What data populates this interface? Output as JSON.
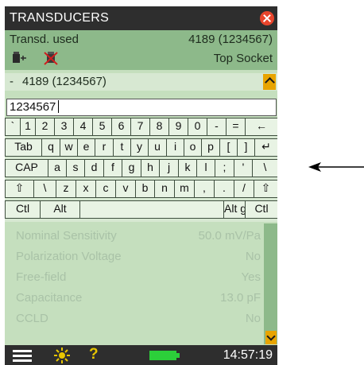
{
  "title": "TRANSDUCERS",
  "header": {
    "label": "Transd. used",
    "transducer": "4189 (1234567)",
    "socket": "Top Socket"
  },
  "dropdown": {
    "prefix": "-",
    "value": "4189 (1234567)"
  },
  "input": {
    "value": "1234567"
  },
  "keyboard": {
    "rows": [
      [
        "`",
        "1",
        "2",
        "3",
        "4",
        "5",
        "6",
        "7",
        "8",
        "9",
        "0",
        "-",
        "=",
        "←"
      ],
      [
        "Tab",
        "q",
        "w",
        "e",
        "r",
        "t",
        "y",
        "u",
        "i",
        "o",
        "p",
        "[",
        "]",
        "↵"
      ],
      [
        "CAP",
        "a",
        "s",
        "d",
        "f",
        "g",
        "h",
        "j",
        "k",
        "l",
        ";",
        "'",
        "\\"
      ],
      [
        "⇧",
        "\\",
        "z",
        "x",
        "c",
        "v",
        "b",
        "n",
        "m",
        ",",
        ".",
        "/",
        "⇧"
      ],
      [
        "Ctl",
        "Alt",
        "",
        "Alt gr",
        "Ctl"
      ]
    ]
  },
  "list": [
    {
      "name": "Nominal Sensitivity",
      "value": "50.0 mV/Pa"
    },
    {
      "name": "Polarization Voltage",
      "value": "No"
    },
    {
      "name": "Free-field",
      "value": "Yes"
    },
    {
      "name": "Capacitance",
      "value": "13.0 pF"
    },
    {
      "name": "CCLD",
      "value": "No"
    }
  ],
  "status": {
    "help": "?",
    "time": "14:57:19"
  },
  "colors": {
    "accent": "#e8a400",
    "header_bg": "#8db98a",
    "panel_bg": "#c5dfbe",
    "battery": "#2ccf3a"
  },
  "icons": [
    "close-icon",
    "transducer-icon",
    "transducer-disabled-icon",
    "scroll-up-icon",
    "scroll-down-icon",
    "menu-icon",
    "sun-icon",
    "help-icon",
    "battery-icon",
    "arrow-icon"
  ]
}
